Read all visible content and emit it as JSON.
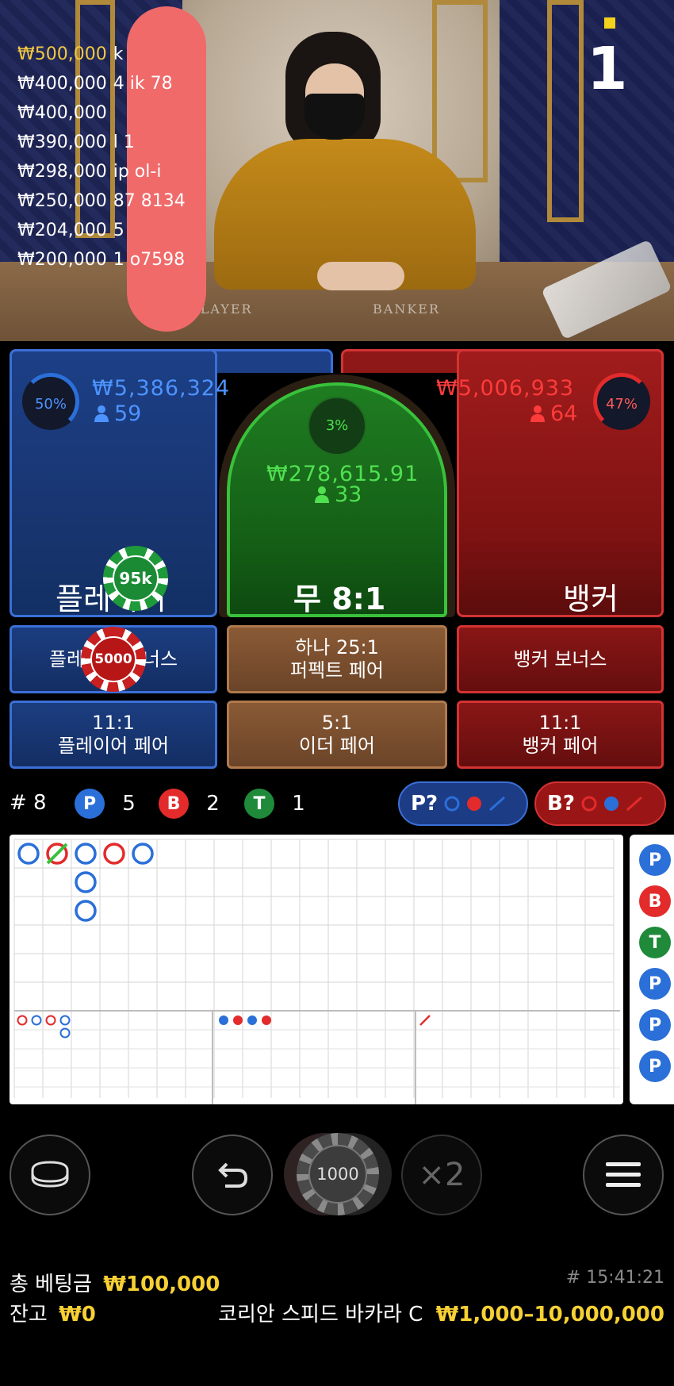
{
  "video": {
    "round_number": "1",
    "felt_labels": {
      "player": "PLAYER",
      "banker": "BANKER"
    },
    "winners": [
      {
        "amount": "₩500,000",
        "name": "k"
      },
      {
        "amount": "₩400,000",
        "name": "4 ik 78"
      },
      {
        "amount": "₩400,000",
        "name": ""
      },
      {
        "amount": "₩390,000",
        "name": "l 1"
      },
      {
        "amount": "₩298,000",
        "name": "ip ol-i"
      },
      {
        "amount": "₩250,000",
        "name": "87 8134"
      },
      {
        "amount": "₩204,000",
        "name": "5"
      },
      {
        "amount": "₩200,000",
        "name": "1 o7598"
      }
    ]
  },
  "bets": {
    "player": {
      "percent": "50%",
      "amount": "₩5,386,324",
      "count": "59",
      "title": "플레이어",
      "chip": "95k"
    },
    "tie": {
      "percent": "3%",
      "amount": "₩278,615.91",
      "count": "33",
      "title": "무 8:1"
    },
    "banker": {
      "percent": "47%",
      "amount": "₩5,006,933",
      "count": "64",
      "title": "뱅커"
    }
  },
  "side_bets": {
    "player_bonus": {
      "label": "플레이어 보너스",
      "chip": "5000"
    },
    "perfect_pair": {
      "odds": "하나 25:1",
      "label": "퍼펙트 페어"
    },
    "banker_bonus": {
      "label": "뱅커 보너스"
    },
    "player_pair": {
      "odds": "11:1",
      "label": "플레이어 페어"
    },
    "either_pair": {
      "odds": "5:1",
      "label": "이더 페어"
    },
    "banker_pair": {
      "odds": "11:1",
      "label": "뱅커 페어"
    }
  },
  "stats": {
    "round": "# 8",
    "player": {
      "badge": "P",
      "count": "5"
    },
    "banker": {
      "badge": "B",
      "count": "2"
    },
    "tie": {
      "badge": "T",
      "count": "1"
    },
    "player_predict": "P?",
    "banker_predict": "B?"
  },
  "roadmap": {
    "big_road": [
      {
        "col": 0,
        "row": 0,
        "result": "P",
        "tie": false
      },
      {
        "col": 1,
        "row": 0,
        "result": "B",
        "tie": true
      },
      {
        "col": 2,
        "row": 0,
        "result": "P",
        "tie": false
      },
      {
        "col": 2,
        "row": 1,
        "result": "P",
        "tie": false
      },
      {
        "col": 2,
        "row": 2,
        "result": "P",
        "tie": false
      },
      {
        "col": 3,
        "row": 0,
        "result": "B",
        "tie": false
      },
      {
        "col": 4,
        "row": 0,
        "result": "P",
        "tie": false
      }
    ],
    "side_results": [
      "P",
      "B",
      "T",
      "P",
      "P",
      "P"
    ]
  },
  "controls": {
    "selected_chip": "1000",
    "double_label": "×2"
  },
  "footer": {
    "total_bet_label": "총 베팅금",
    "total_bet": "₩100,000",
    "balance_label": "잔고",
    "balance": "₩0",
    "game_id": "# 15:41:21",
    "table_name": "코리안 스피드 바카라 C",
    "limits": "₩1,000–10,000,000"
  },
  "colors": {
    "player": "#2b6fd8",
    "banker": "#e32b2b",
    "tie": "#39c13c",
    "accent": "#f6d034"
  }
}
